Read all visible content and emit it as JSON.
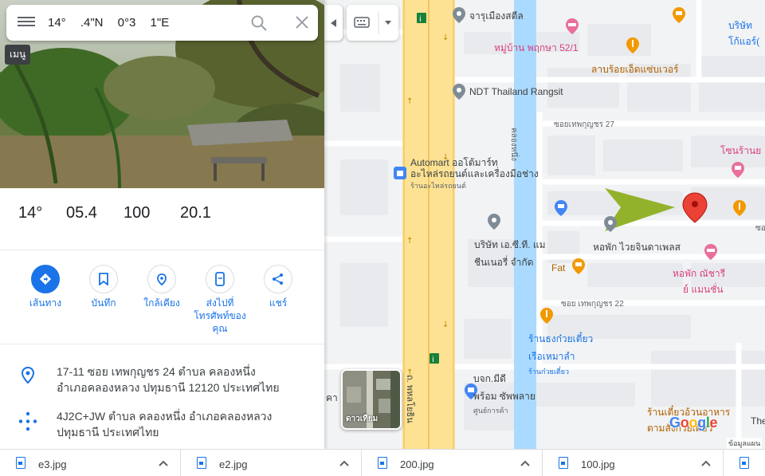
{
  "search": {
    "value": "14° .4\"N 0°3 1\"E"
  },
  "menu_tooltip": "เมนู",
  "coordinates": [
    "14°",
    "05.4",
    "100",
    "20.1"
  ],
  "actions": [
    {
      "label": "เส้นทาง",
      "icon": "directions-icon"
    },
    {
      "label": "บันทึก",
      "icon": "bookmark-icon"
    },
    {
      "label": "ใกล้เคียง",
      "icon": "nearby-icon"
    },
    {
      "label": "ส่งไปที่\nโทรศัพท์ของ\nคุณ",
      "icon": "send-to-phone-icon"
    },
    {
      "label": "แชร์",
      "icon": "share-icon"
    }
  ],
  "address": "17-11 ซอย เทพกุญชร 24 ตำบล คลองหนึ่ง อำเภอคลองหลวง ปทุมธานี 12120 ประเทศไทย",
  "plus_code": "4J2C+JW ตำบล คลองหนึ่ง อำเภอคลองหลวง ปทุมธานี ประเทศไทย",
  "map": {
    "labels": {
      "jaru": "จารุเมืองสตีล",
      "muban": "หมู่บ้าน พฤกษา 52/1",
      "larb": "ลาบร้อยเอ็ดแซ่บเวอร์",
      "borisat_top": "บริษัท",
      "kokae": "โก้แอร์(",
      "ndt": "NDT Thailand Rangsit",
      "soi27": "ซอยเทพกุญชร 27",
      "khlong": "คลองหนึ่ง",
      "zone": "โซนร้านย",
      "automart1": "Automart ออโต้มาร์ท",
      "automart2": "อะไหล่รถยนต์และเครื่องมือช่าง",
      "automart3": "ร้านอะไหล่รถยนต์",
      "bsc1": "บริษัท เอ.ซี.ที. แม",
      "bsc2": "ชีนเนอรี่ จำกัด",
      "waijinda": "หอพัก ไวยจินดาเพลส",
      "natchari1": "หอพัก ณัชารี",
      "natchari2": "ย์ แมนชั่น",
      "fat": "Fat",
      "soi22": "ซอย เทพกุญชร 22",
      "noodle1": "ร้านธงก๋วยเตี๋ยว",
      "noodle2": "เรือเหมาลำ",
      "noodle3": "ร้านก๋วยเตี๋ยว",
      "bkj1": "บจก.มีดี",
      "bkj2": "พร้อม ซัพพลาย",
      "bkj3": "ศูนย์การค้า",
      "phahol": "ถ. พหลโยธิน",
      "tedd": "ร้านเตี๋ยวอ้วนอาหาร",
      "tamsang": "ตามสั่งก๊วยเตี๋ยว",
      "the": "The",
      "kha": "คา",
      "soi_right": "ซอ"
    },
    "layers_label": "ดาวเทียม",
    "google": "Google",
    "data_label": "ข้อมูลแผน"
  },
  "downloads": [
    {
      "name": "e3.jpg"
    },
    {
      "name": "e2.jpg"
    },
    {
      "name": "200.jpg"
    },
    {
      "name": "100.jpg"
    }
  ],
  "colors": {
    "accent": "#1a73e8",
    "pin": "#ea4335",
    "arrow": "#8bad1a",
    "water": "#aadaff",
    "highway": "#fde293"
  }
}
